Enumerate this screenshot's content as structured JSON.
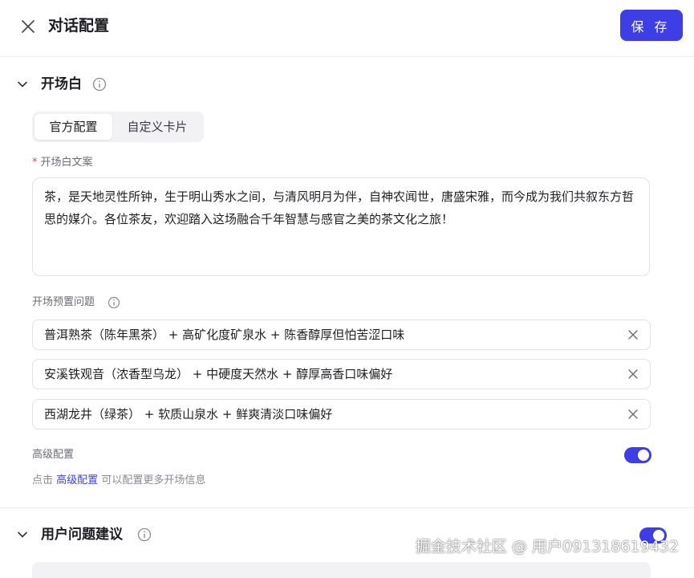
{
  "header": {
    "title": "对话配置",
    "save_label": "保 存"
  },
  "opening": {
    "title": "开场白",
    "tabs": [
      {
        "label": "官方配置",
        "active": true
      },
      {
        "label": "自定义卡片",
        "active": false
      }
    ],
    "copy_label": "开场白文案",
    "copy_text": "茶，是天地灵性所钟，生于明山秀水之间，与清风明月为伴，自神农闻世，唐盛宋雅，而今成为我们共叙东方哲思的媒介。各位茶友，欢迎踏入这场融合千年智慧与感官之美的茶文化之旅！",
    "questions_label": "开场预置问题",
    "questions": [
      "普洱熟茶（陈年黑茶） + 高矿化度矿泉水 + 陈香醇厚但怕苦涩口味",
      "安溪铁观音（浓香型乌龙） + 中硬度天然水 + 醇厚高香口味偏好",
      "西湖龙井（绿茶） + 软质山泉水 + 鲜爽清淡口味偏好"
    ],
    "advanced_label": "高级配置",
    "advanced_enabled": true,
    "hint_prefix": "点击",
    "hint_link": "高级配置",
    "hint_suffix": "可以配置更多开场信息"
  },
  "suggestions": {
    "title": "用户问题建议",
    "enabled": true
  },
  "watermark": "掘金技术社区 @ 用户091318619432",
  "colors": {
    "accent": "#3d3ee6",
    "border": "#e2e2e8"
  }
}
